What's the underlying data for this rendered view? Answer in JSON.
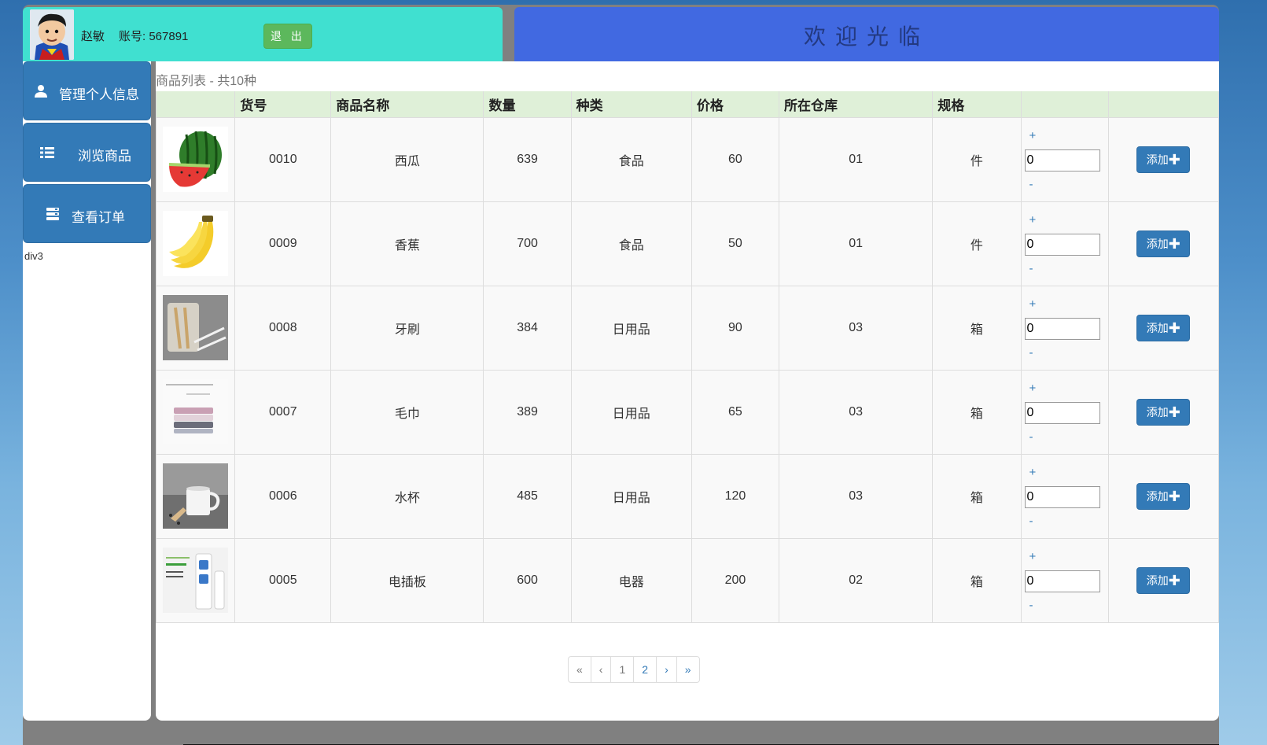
{
  "header": {
    "user_name": "赵敏",
    "account": "账号: 567891",
    "logout_label": "退 出",
    "welcome": "欢迎光临"
  },
  "sidebar": {
    "items": [
      {
        "label": "管理个人信息",
        "icon": "user-icon"
      },
      {
        "label": "浏览商品",
        "icon": "list-icon"
      },
      {
        "label": "查看订单",
        "icon": "tasks-icon"
      }
    ],
    "div3": "div3"
  },
  "main": {
    "list_title": "商品列表 - 共10种",
    "columns": [
      "",
      "货号",
      "商品名称",
      "数量",
      "种类",
      "价格",
      "所在仓库",
      "规格",
      "",
      ""
    ],
    "rows": [
      {
        "image": "watermelon-image",
        "id": "0010",
        "name": "西瓜",
        "qty": "639",
        "category": "食品",
        "price": "60",
        "warehouse": "01",
        "unit": "件",
        "input": "0"
      },
      {
        "image": "banana-image",
        "id": "0009",
        "name": "香蕉",
        "qty": "700",
        "category": "食品",
        "price": "50",
        "warehouse": "01",
        "unit": "件",
        "input": "0"
      },
      {
        "image": "toothbrush-image",
        "id": "0008",
        "name": "牙刷",
        "qty": "384",
        "category": "日用品",
        "price": "90",
        "warehouse": "03",
        "unit": "箱",
        "input": "0"
      },
      {
        "image": "towel-image",
        "id": "0007",
        "name": "毛巾",
        "qty": "389",
        "category": "日用品",
        "price": "65",
        "warehouse": "03",
        "unit": "箱",
        "input": "0"
      },
      {
        "image": "cup-image",
        "id": "0006",
        "name": "水杯",
        "qty": "485",
        "category": "日用品",
        "price": "120",
        "warehouse": "03",
        "unit": "箱",
        "input": "0"
      },
      {
        "image": "power-strip-image",
        "id": "0005",
        "name": "电插板",
        "qty": "600",
        "category": "电器",
        "price": "200",
        "warehouse": "02",
        "unit": "箱",
        "input": "0"
      }
    ],
    "qty_plus": "+",
    "qty_minus": "-",
    "add_label": "添加"
  },
  "pager": {
    "first": "«",
    "prev": "‹",
    "pages": [
      "1",
      "2"
    ],
    "next": "›",
    "last": "»"
  },
  "colors": {
    "header_left": "#40e0d0",
    "header_right": "#4169e1",
    "nav": "#337ab7",
    "table_head": "#dff0d8",
    "logout": "#5cb85c"
  }
}
